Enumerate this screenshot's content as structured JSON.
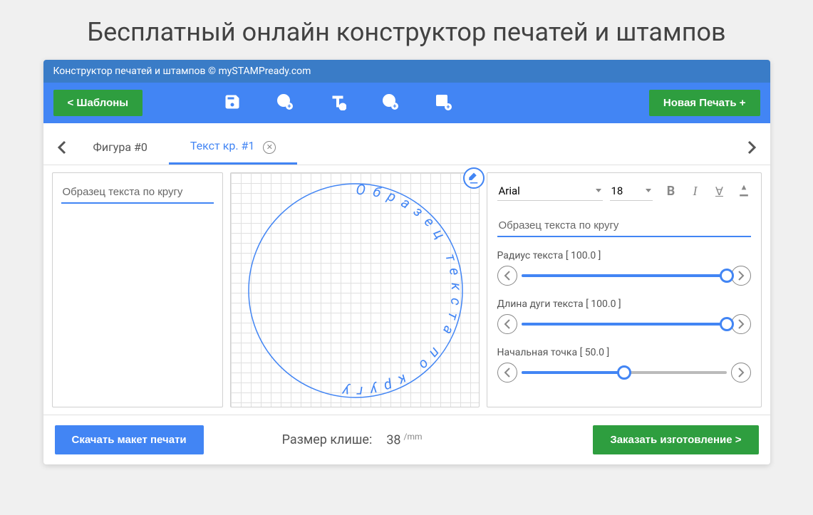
{
  "page": {
    "title": "Бесплатный онлайн конструктор печатей и штампов"
  },
  "titlebar": "Конструктор печатей и штампов © mySTAMPready.com",
  "toolbar": {
    "templates": "<   Шаблоны",
    "new_stamp": "Новая Печать +"
  },
  "tabs": [
    {
      "label": "Фигура #0",
      "active": false,
      "closable": false
    },
    {
      "label": "Текст кр. #1",
      "active": true,
      "closable": true
    }
  ],
  "left": {
    "sample_text": "Образец текста по кругу"
  },
  "canvas": {
    "circle_text": "Образец текста по кругу"
  },
  "right": {
    "font": "Arial",
    "size": "18",
    "text_value": "Образец текста по кругу",
    "sliders": [
      {
        "label": "Радиус текста [ 100.0 ]",
        "value": 100
      },
      {
        "label": "Длина дуги текста [ 100.0 ]",
        "value": 100
      },
      {
        "label": "Начальная точка [ 50.0 ]",
        "value": 50
      }
    ]
  },
  "footer": {
    "download": "Скачать макет печати",
    "size_label": "Размер клише:",
    "size_value": "38",
    "size_unit": "/mm",
    "order": "Заказать изготовление >"
  }
}
